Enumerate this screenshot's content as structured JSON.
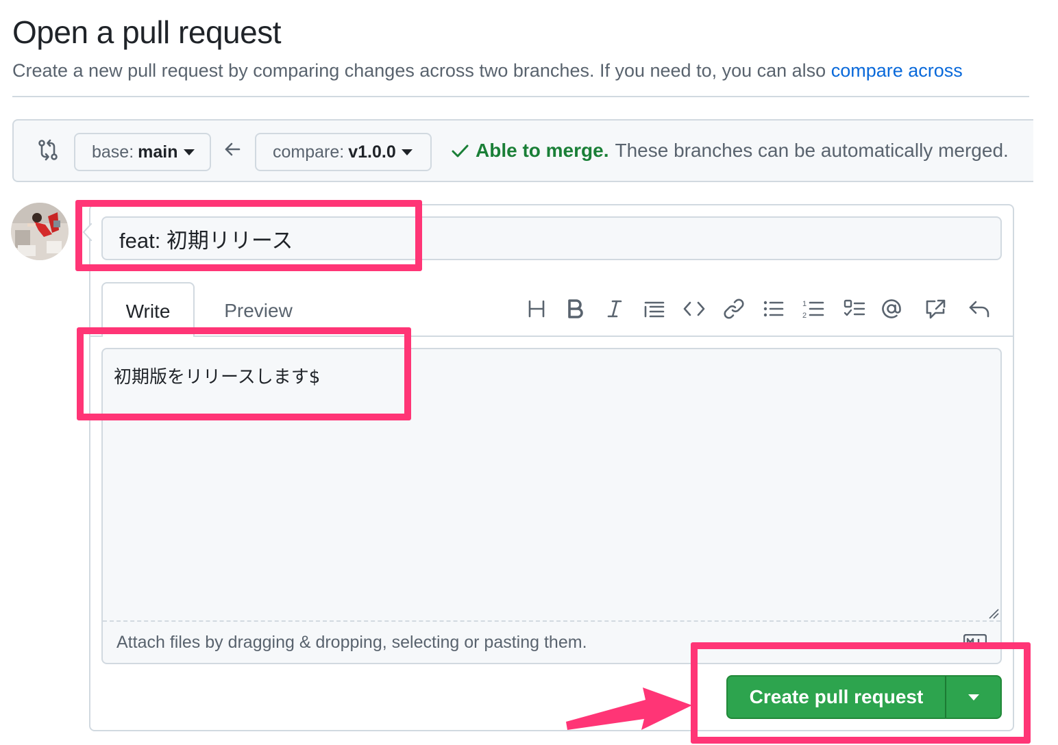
{
  "page": {
    "title": "Open a pull request",
    "subtitle_prefix": "Create a new pull request by comparing changes across two branches. If you need to, you can also ",
    "subtitle_link": "compare across"
  },
  "compare": {
    "base_label": "base:",
    "base_branch": "main",
    "compare_label": "compare:",
    "compare_branch": "v1.0.0",
    "merge_status_strong": "Able to merge.",
    "merge_status_text": "These branches can be automatically merged."
  },
  "form": {
    "title_value": "feat: 初期リリース",
    "tab_write": "Write",
    "tab_preview": "Preview",
    "body_value": "初期版をリリースします$",
    "attach_hint": "Attach files by dragging & dropping, selecting or pasting them.",
    "submit_label": "Create pull request"
  },
  "toolbar_icons": [
    "heading-icon",
    "bold-icon",
    "italic-icon",
    "quote-icon",
    "code-icon",
    "link-icon",
    "bulleted-list-icon",
    "numbered-list-icon",
    "task-list-icon",
    "mention-icon",
    "cross-reference-icon",
    "reply-icon"
  ],
  "colors": {
    "accent_green": "#2da44e",
    "merge_green": "#1a7f37",
    "link_blue": "#0969da",
    "highlight_pink": "#ff3576"
  }
}
